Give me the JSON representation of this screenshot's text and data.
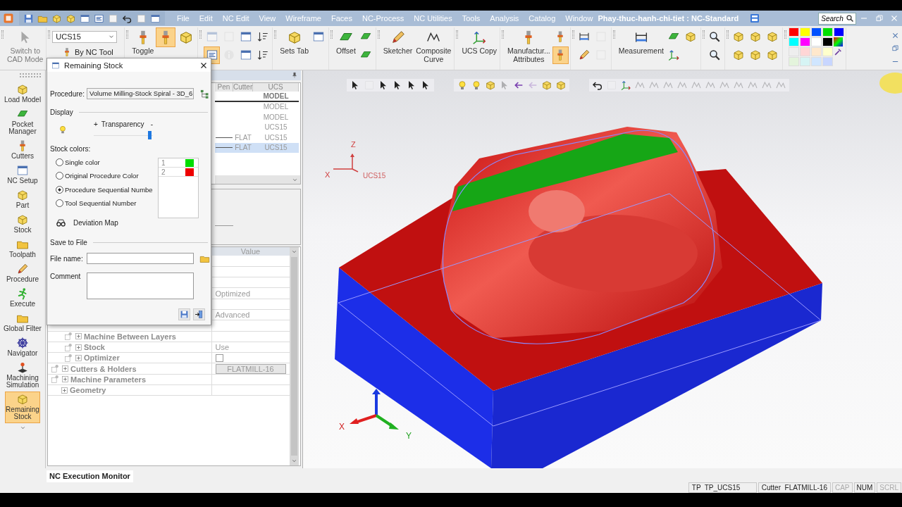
{
  "title_bar": {
    "menus": [
      "File",
      "Edit",
      "NC Edit",
      "View",
      "Wireframe",
      "Faces",
      "NC-Process",
      "NC Utilities",
      "Tools",
      "Analysis",
      "Catalog",
      "Window"
    ],
    "title": "Phay-thuc-hanh-chi-tiet : NC-Standard",
    "search": {
      "placeholder": "Search"
    }
  },
  "ribbon": {
    "groups": [
      {
        "items": [
          {
            "kind": "large",
            "label": "Switch to\nCAD Mode",
            "on": false,
            "disabled": true
          }
        ]
      },
      {
        "items": [
          {
            "kind": "combo",
            "value": "UCS15"
          },
          {
            "kind": "small",
            "label": "By NC Tool",
            "on": false,
            "disabled": false
          }
        ]
      },
      {
        "items": [
          {
            "kind": "large",
            "label": "Toggle",
            "on": false,
            "disabled": false
          },
          {
            "kind": "large",
            "on": true,
            "disabled": false
          },
          {
            "kind": "large",
            "on": false,
            "disabled": false
          }
        ]
      },
      {
        "items": [
          {
            "kind": "small",
            "on": false,
            "disabled": true
          },
          {
            "kind": "small",
            "on": true,
            "disabled": false
          },
          {
            "kind": "small",
            "on": false,
            "disabled": true
          },
          {
            "kind": "small",
            "on": false,
            "disabled": true
          },
          {
            "kind": "small",
            "on": false,
            "disabled": false
          },
          {
            "kind": "small",
            "on": false,
            "disabled": false
          },
          {
            "kind": "small",
            "on": false,
            "disabled": false
          },
          {
            "kind": "small",
            "on": false,
            "disabled": false
          }
        ]
      },
      {
        "items": [
          {
            "kind": "large",
            "label": "Sets Tab",
            "on": false,
            "disabled": false
          },
          {
            "kind": "small",
            "on": false,
            "disabled": false
          }
        ]
      },
      {
        "items": [
          {
            "kind": "large",
            "label": "Offset",
            "on": false,
            "disabled": false
          },
          {
            "kind": "small",
            "on": false,
            "disabled": false
          },
          {
            "kind": "small",
            "on": false,
            "disabled": false
          }
        ]
      },
      {
        "items": [
          {
            "kind": "large",
            "label": "Sketcher",
            "on": false,
            "disabled": false
          },
          {
            "kind": "large",
            "label": "Composite\nCurve",
            "on": false,
            "disabled": false
          }
        ]
      },
      {
        "items": [
          {
            "kind": "large",
            "label": "UCS Copy",
            "on": false,
            "disabled": false
          }
        ]
      },
      {
        "items": [
          {
            "kind": "large",
            "label": "Manufactur...\nAttributes",
            "on": false,
            "disabled": false
          },
          {
            "kind": "small",
            "on": false,
            "disabled": false
          },
          {
            "kind": "small",
            "on": true,
            "disabled": false
          }
        ]
      },
      {
        "items": [
          {
            "kind": "small",
            "on": false,
            "disabled": false
          },
          {
            "kind": "small",
            "on": false,
            "disabled": false
          },
          {
            "kind": "small",
            "on": false,
            "disabled": true
          },
          {
            "kind": "small",
            "on": false,
            "disabled": true
          }
        ]
      },
      {
        "items": [
          {
            "kind": "large",
            "label": "Measurement",
            "on": false,
            "disabled": false
          },
          {
            "kind": "small",
            "on": false,
            "disabled": false
          },
          {
            "kind": "small",
            "on": false,
            "disabled": false
          },
          {
            "kind": "small",
            "on": false,
            "disabled": false
          }
        ]
      },
      {
        "items": [
          {
            "kind": "small",
            "on": false,
            "disabled": false
          },
          {
            "kind": "small",
            "on": false,
            "disabled": false
          }
        ]
      },
      {
        "items": [
          {
            "kind": "small",
            "on": false,
            "disabled": false
          },
          {
            "kind": "small",
            "on": false,
            "disabled": false
          },
          {
            "kind": "small",
            "on": false,
            "disabled": false
          },
          {
            "kind": "small",
            "on": false,
            "disabled": false
          },
          {
            "kind": "small",
            "on": false,
            "disabled": false
          },
          {
            "kind": "small",
            "on": false,
            "disabled": false
          }
        ]
      },
      {
        "items": [
          {
            "kind": "palette",
            "swatches": [
              {
                "color": "#ff0000"
              },
              {
                "color": "#ffff00"
              },
              {
                "color": "#0050ff"
              },
              {
                "color": "#00e000"
              },
              {
                "color": "#0000ff"
              },
              {
                "color": "#00ffff"
              },
              {
                "color": "#ff00ff"
              },
              {
                "color": "#ffffff"
              },
              {
                "color": "#000000"
              },
              {
                "color": "#eeeeee"
              },
              {
                "color": "#ffd6d6"
              },
              {
                "color": "#ffe8cc"
              },
              {
                "color": "#ffffcc"
              },
              {
                "color": "#e4f4dc"
              },
              {
                "color": "#d6f4f4"
              },
              {
                "color": "#d0e6ff"
              },
              {
                "color": "#c8d6ff"
              }
            ]
          }
        ]
      }
    ]
  },
  "left_toolbar": {
    "items": [
      {
        "label": "Load Model",
        "selected": false
      },
      {
        "label": "Pocket\nManager",
        "selected": false
      },
      {
        "label": "Cutters",
        "selected": false
      },
      {
        "label": "NC Setup",
        "selected": false
      },
      {
        "label": "Part",
        "selected": false
      },
      {
        "label": "Stock",
        "selected": false
      },
      {
        "label": "Toolpath",
        "selected": false
      },
      {
        "label": "Procedure",
        "selected": false
      },
      {
        "label": "Execute",
        "selected": false
      },
      {
        "label": "Global Filter",
        "selected": false
      },
      {
        "label": "Navigator",
        "selected": false
      },
      {
        "label": "Machining\nSimulation",
        "selected": false
      },
      {
        "label": "Remaining\nStock",
        "selected": true
      }
    ]
  },
  "process_tree": {
    "columns": [
      "Pen",
      "Cutter",
      "UCS"
    ],
    "rows": [
      {
        "ucs": "MODEL",
        "current": true,
        "selected": false
      },
      {
        "ucs": "MODEL",
        "current": false,
        "selected": false
      },
      {
        "ucs": "MODEL",
        "current": false,
        "selected": false
      },
      {
        "ucs": "UCS15",
        "current": false,
        "selected": false
      },
      {
        "cutter": "FLAT",
        "ucs": "UCS15",
        "current": false,
        "selected": false
      },
      {
        "cutter": "FLAT",
        "ucs": "UCS15",
        "current": false,
        "selected": true
      }
    ]
  },
  "property_grid": {
    "value_header": "Value",
    "rows": [
      {
        "kind": "blank"
      },
      {
        "kind": "blank"
      },
      {
        "kind": "blank"
      },
      {
        "kind": "value",
        "value": "Optimized"
      },
      {
        "kind": "blank"
      },
      {
        "kind": "value",
        "value": "Advanced"
      },
      {
        "kind": "group",
        "children": [
          {
            "kind": "item",
            "name": "Machine Between Layers",
            "node_icon": true,
            "expanded": false
          },
          {
            "kind": "item",
            "name": "Stock",
            "value": "Use",
            "node_icon": true,
            "expanded": false
          },
          {
            "kind": "checkbox_item",
            "name": "Optimizer",
            "checked": false,
            "node_icon": true,
            "expanded": false
          }
        ]
      },
      {
        "kind": "button_item",
        "name": "Cutters & Holders",
        "value": "FLATMILL-16",
        "node_icon": true,
        "expanded": false
      },
      {
        "kind": "item",
        "name": "Machine Parameters",
        "node_icon": true,
        "expanded": false
      },
      {
        "kind": "item",
        "name": "Geometry",
        "node_icon": false,
        "expanded": false
      }
    ]
  },
  "dialog": {
    "title": "Remaining Stock",
    "procedure_label": "Procedure:",
    "procedure": "Volume Milling-Stock Spiral - 3D_6",
    "display_header": "Display",
    "transparency": {
      "label": "Transparency",
      "plus": "+",
      "minus": "-",
      "level": 0.97
    },
    "stock_colors": {
      "label": "Stock colors:",
      "options": [
        {
          "label": "Single color",
          "selected": false
        },
        {
          "label": "Original Procedure Color",
          "selected": false
        },
        {
          "label": "Procedure Sequential Numbe",
          "selected": true
        },
        {
          "label": "Tool Sequential Number",
          "selected": false
        }
      ],
      "list": [
        {
          "index": "1",
          "color": "#00dd00"
        },
        {
          "index": "2",
          "color": "#ee0000"
        }
      ]
    },
    "deviation_map": "Deviation Map",
    "save_header": "Save to File",
    "file_name_label": "File name:",
    "comment_label": "Comment"
  },
  "viewport": {
    "ucs_marker": {
      "z_label": "Z",
      "x_label": "X",
      "name": "UCS15"
    },
    "axes_triad": {
      "x_label": "X",
      "y_label": "Y"
    }
  },
  "bottom_tab": "NC Execution Monitor",
  "status_bar": {
    "fields": [
      "TP  TP_UCS15",
      "Cutter  FLATMILL-16"
    ],
    "indicators": [
      {
        "text": "CAP",
        "on": false
      },
      {
        "text": "NUM",
        "on": true
      },
      {
        "text": "SCRL",
        "on": false
      }
    ]
  }
}
